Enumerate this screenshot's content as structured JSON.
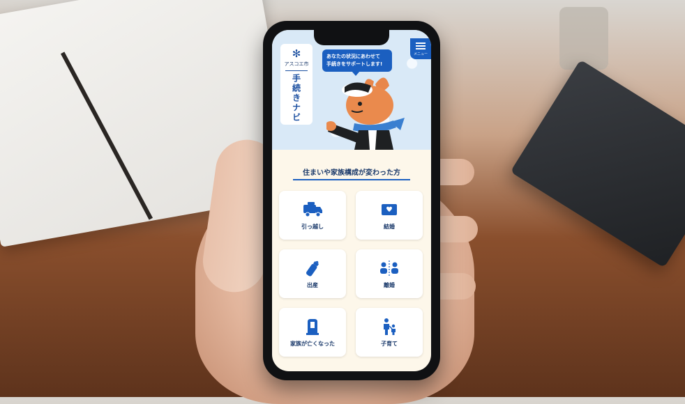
{
  "app": {
    "city_name": "アスコエ市",
    "app_name": "手続きナビ",
    "menu_label": "メニュー"
  },
  "hero": {
    "bubble_line1": "あなたの状況にあわせて",
    "bubble_line2": "手続きをサポートします!"
  },
  "section": {
    "title": "住まいや家族構成が変わった方"
  },
  "tiles": [
    {
      "label": "引っ越し",
      "icon": "moving-truck-icon"
    },
    {
      "label": "結婚",
      "icon": "envelope-heart-icon"
    },
    {
      "label": "出産",
      "icon": "baby-bottle-icon"
    },
    {
      "label": "離婚",
      "icon": "separated-people-icon"
    },
    {
      "label": "家族が亡くなった",
      "icon": "memorial-icon"
    },
    {
      "label": "子育て",
      "icon": "parent-child-icon"
    }
  ],
  "colors": {
    "accent": "#1b5fc0",
    "text_dark": "#1b3a6b",
    "hero_bg": "#d9e9f7",
    "page_bg": "#fdf7ea"
  }
}
